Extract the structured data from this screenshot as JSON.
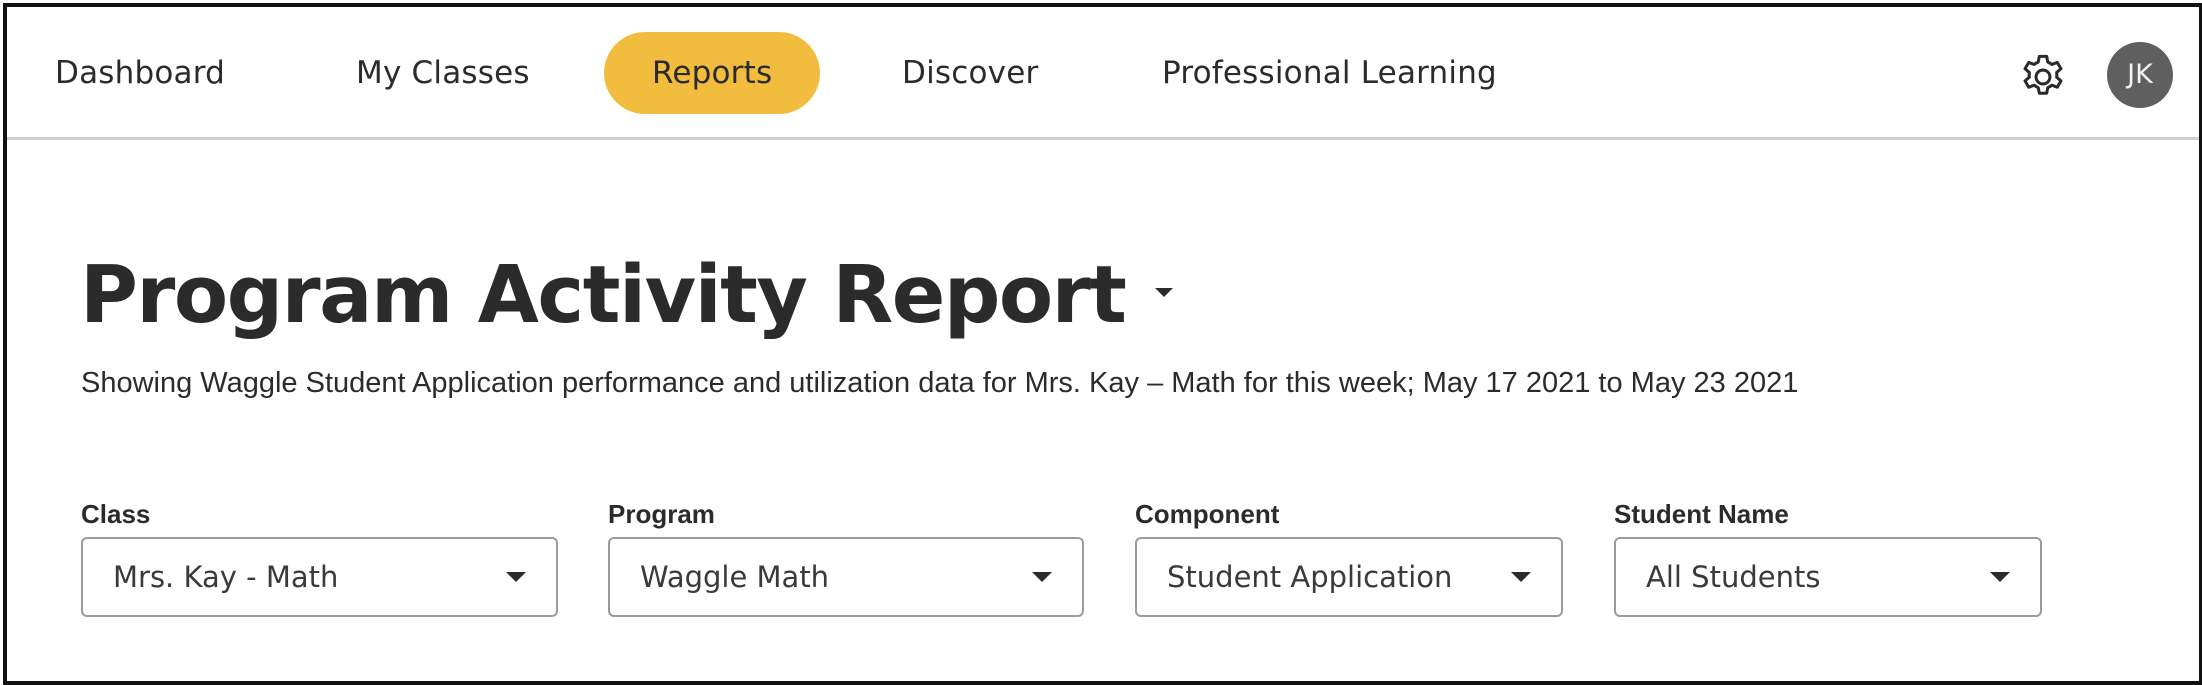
{
  "nav": {
    "items": [
      {
        "label": "Dashboard",
        "active": false
      },
      {
        "label": "My Classes",
        "active": false
      },
      {
        "label": "Reports",
        "active": true
      },
      {
        "label": "Discover",
        "active": false
      },
      {
        "label": "Professional Learning",
        "active": false
      }
    ],
    "settings_icon": "gear-icon",
    "avatar_initials": "JK"
  },
  "report": {
    "title": "Program Activity Report",
    "subtitle": "Showing Waggle Student Application performance and utilization data for Mrs. Kay – Math for this week; May 17 2021 to May 23 2021"
  },
  "filters": [
    {
      "label": "Class",
      "value": "Mrs. Kay - Math"
    },
    {
      "label": "Program",
      "value": "Waggle Math"
    },
    {
      "label": "Component",
      "value": "Student Application"
    },
    {
      "label": "Student Name",
      "value": "All Students"
    }
  ],
  "colors": {
    "accent": "#f2bd3f",
    "avatar_bg": "#5f5f5f",
    "text": "#2b2b2b"
  }
}
